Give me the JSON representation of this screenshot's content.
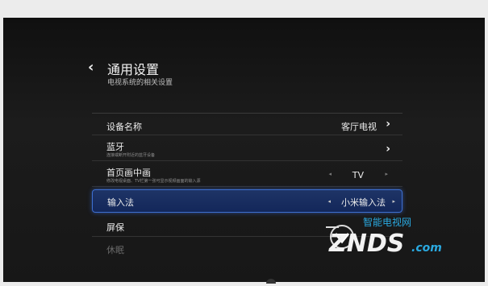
{
  "header": {
    "title": "通用设置",
    "subtitle": "电视系统的相关设置"
  },
  "rows": [
    {
      "label": "设备名称",
      "value": "客厅电视"
    },
    {
      "label": "蓝牙",
      "desc": "连接或断开附近的蓝牙设备"
    },
    {
      "label": "首页画中画",
      "desc": "修改电视桌面、TV栏第一张可显示视频画面的输入源",
      "value": "TV"
    },
    {
      "label": "输入法",
      "value": "小米输入法"
    },
    {
      "label": "屏保"
    },
    {
      "label": "休眠"
    }
  ],
  "watermark": {
    "brand_cn": "智能电视网",
    "brand_en": "ZNDS",
    "domain": ".com"
  },
  "colors": {
    "selected_border": "#3d6fd0",
    "selected_bg": "#1e3466",
    "watermark_blue": "#2aa9e0"
  },
  "icons": {
    "back": "chevron-left-icon",
    "row_next": "chevron-right-icon",
    "option_prev": "caret-left-icon",
    "option_next": "caret-right-icon"
  }
}
